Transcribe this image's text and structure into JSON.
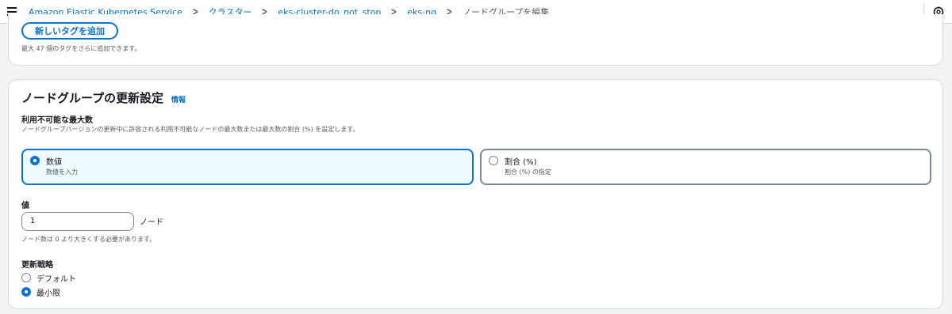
{
  "breadcrumb": {
    "items": [
      "Amazon Elastic Kubernetes Service",
      "クラスター",
      "eks-cluster-do_not_stop",
      "eks-ng"
    ],
    "current": "ノードグループを編集"
  },
  "icons": {
    "menu": "hamburger-menu-icon",
    "settings": "settings-icon",
    "separator": "chevron-right-icon"
  },
  "tags": {
    "add_button": "新しいタグを追加",
    "hint": "最大 47 個のタグをさらに追加できます。"
  },
  "update_config": {
    "title": "ノードグループの更新設定",
    "info": "情報",
    "max_unavailable": {
      "label": "利用不可能な最大数",
      "description": "ノードグループバージョンの更新中に許容される利用不可能なノードの最大数または最大数の割合 (%) を設定します。",
      "options": [
        {
          "label": "数値",
          "description": "数値を入力",
          "selected": true
        },
        {
          "label": "割合 (%)",
          "description": "割合 (%) の指定",
          "selected": false
        }
      ]
    },
    "value": {
      "label": "値",
      "input_value": "1",
      "unit": "ノード",
      "hint": "ノード数は 0 より大きくする必要があります。"
    },
    "strategy": {
      "label": "更新戦略",
      "options": [
        {
          "label": "デフォルト",
          "selected": false
        },
        {
          "label": "最小限",
          "selected": true
        }
      ]
    }
  },
  "colors": {
    "accent": "#0972d3",
    "link": "#0073bb",
    "selected_tile_bg": "#f0fbff",
    "page_bg": "#f2f3f3"
  }
}
